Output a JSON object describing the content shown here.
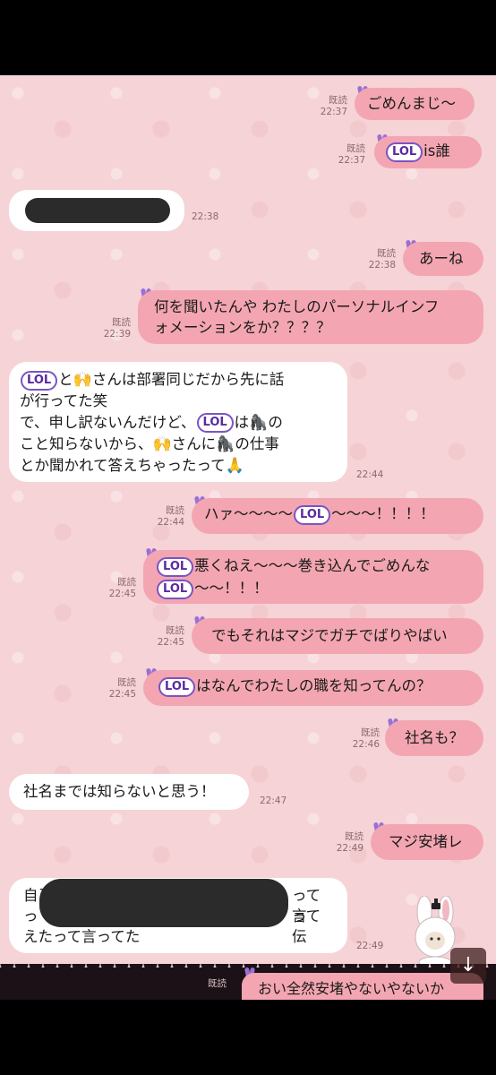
{
  "messages": {
    "m1": {
      "text": "ごめんまじ〜",
      "read": "既読",
      "time": "22:37"
    },
    "m2": {
      "text": "is誰",
      "read": "既読",
      "time": "22:37"
    },
    "m3": {
      "time": "22:38"
    },
    "m4": {
      "text": "あーね",
      "read": "既読",
      "time": "22:38"
    },
    "m5": {
      "line1": "何を聞いたんや わたしのパーソナルインフ",
      "line2": "ォメーションをか？？？？",
      "read": "既読",
      "time": "22:39"
    },
    "m6": {
      "l1a": "と",
      "l1b": "さんは部署同じだから先に話",
      "line2": "が行ってた笑",
      "l3a": "で、申し訳ないんだけど、",
      "l3b": "は",
      "l3c": "の",
      "l4a": "こと知らないから、",
      "l4b": "さんに",
      "l4c": "の仕事",
      "line5": "とか聞かれて答えちゃったって",
      "time": "22:44"
    },
    "m7": {
      "a": "ハァ〜〜〜〜",
      "b": "〜〜〜！！！！",
      "read": "既読",
      "time": "22:44"
    },
    "m8": {
      "a": "悪くねえ〜〜〜巻き込んでごめんな",
      "b": "〜〜！！！",
      "read": "既読",
      "time": "22:45"
    },
    "m9": {
      "text": "でもそれはマジでガチでばりやばい",
      "read": "既読",
      "time": "22:45"
    },
    "m10": {
      "text": "はなんでわたしの職を知ってんの？",
      "read": "既読",
      "time": "22:45"
    },
    "m11": {
      "text": "社名も？",
      "read": "既読",
      "time": "22:46"
    },
    "m12": {
      "text": "社名までは知らないと思う！",
      "time": "22:47"
    },
    "m13": {
      "text": "マジ安堵レ",
      "read": "既読",
      "time": "22:49"
    },
    "m14": {
      "a": "自己",
      "b": "って言",
      "c": "っ",
      "d": "って伝",
      "line3": "えたって言ってた",
      "time": "22:49"
    },
    "m15": {
      "text": "おい全然安堵やないやないか",
      "read": "既読"
    }
  },
  "sticker_label": "LOL",
  "icons": {
    "bunny": "bunny-icon",
    "clap": "clap-hands-emoji",
    "gorilla": "gorilla-emoji",
    "pray": "pray-emoji",
    "scroll": "arrow-down-icon"
  },
  "emoji": {
    "clap": "🙌",
    "gorilla": "🦍",
    "pray": "🙏",
    "arrow": "↓"
  },
  "colors": {
    "sent_bubble": "#f3a6b1",
    "recv_bubble": "#ffffff",
    "background": "#f6d3d6",
    "bunny": "#9a6fd6"
  }
}
